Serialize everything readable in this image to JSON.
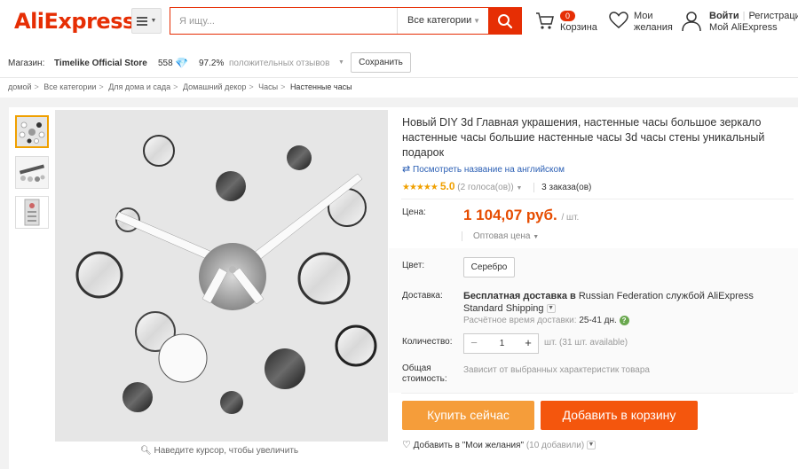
{
  "header": {
    "logo_text": "AliExpress",
    "logo_mark": "®",
    "search_placeholder": "Я ищу...",
    "search_category": "Все категории",
    "cart_count": "0",
    "cart_label": "Корзина",
    "wish_line1": "Мои",
    "wish_line2": "желания",
    "login_label": "Войти",
    "register_label": "Регистрация",
    "my_aliexpress": "Мой AliExpress"
  },
  "store": {
    "label": "Магазин:",
    "name": "Timelike Official Store",
    "score": "558",
    "positive_pct": "97.2%",
    "positive_label": "положительных отзывов",
    "save_button": "Сохранить"
  },
  "breadcrumb": [
    "домой",
    "Все категории",
    "Для дома и сада",
    "Домашний декор",
    "Часы",
    "Настенные часы"
  ],
  "product": {
    "title": "Новый DIY 3d Главная украшения, настенные часы большое зеркало настенные часы большие настенные часы 3d часы стены уникальный подарок",
    "translate_link": "Посмотреть название на английском",
    "rating": 5.0,
    "rating_text": "5.0",
    "votes": "(2 голоса(ов))",
    "orders": "3 заказа(ов)",
    "price_label": "Цена:",
    "price": "1 104,07 руб.",
    "price_unit": "/ шт.",
    "wholesale": "Оптовая цена",
    "color_label": "Цвет:",
    "color_value": "Серебро",
    "shipping_label": "Доставка:",
    "shipping_bold": "Бесплатная доставка в",
    "shipping_rest": " Russian Federation службой AliExpress Standard Shipping",
    "delivery_time_label": "Расчётное время доставки:",
    "delivery_days": "25-41 дн.",
    "qty_label": "Количество:",
    "qty_value": "1",
    "qty_available": "шт. (31 шт. available)",
    "total_label_1": "Общая",
    "total_label_2": "стоимость:",
    "total_value": "Зависит от выбранных характеристик товара",
    "buy_now": "Купить сейчас",
    "add_to_cart": "Добавить в корзину",
    "wishlist_add": "Добавить в \"Мои желания\"",
    "wishlist_count": "(10 добавили)",
    "zoom_hint": "Наведите курсор, чтобы увеличить"
  },
  "colors": {
    "brand": "#e62e04",
    "price": "#e64c00",
    "buy_button": "#f59d3a",
    "cart_button": "#f4560d",
    "star": "#f0a000",
    "link": "#2b5fb4"
  }
}
